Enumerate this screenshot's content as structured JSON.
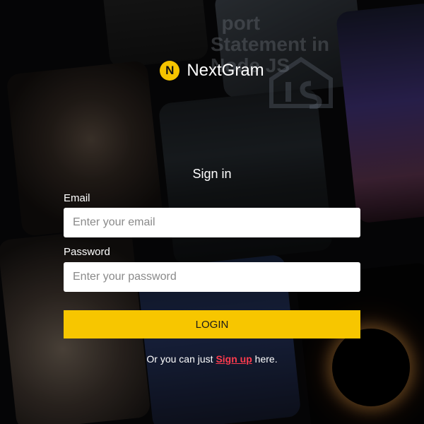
{
  "background": {
    "headline": "  port\nStatement in\nNode JS"
  },
  "brand": {
    "badge_letter": "N",
    "name": "NextGram",
    "accent": "#f5c400"
  },
  "form": {
    "heading": "Sign in",
    "email": {
      "label": "Email",
      "placeholder": "Enter your email",
      "value": ""
    },
    "password": {
      "label": "Password",
      "placeholder": "Enter your password",
      "value": ""
    },
    "submit_label": "LOGIN",
    "signup": {
      "prefix": "Or you can just ",
      "link_text": "Sign up",
      "suffix": " here.",
      "link_color": "#ff3b4e"
    }
  }
}
